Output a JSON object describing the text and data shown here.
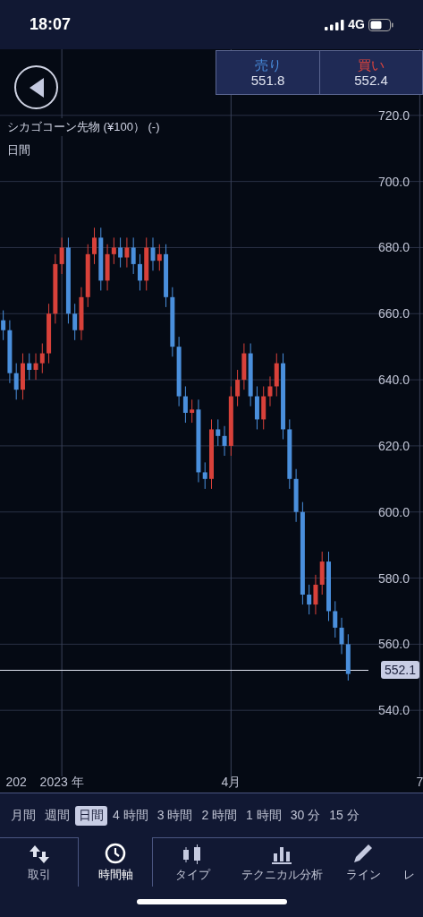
{
  "status_bar": {
    "time": "18:07",
    "network": "4G"
  },
  "quote": {
    "sell": {
      "label": "売り",
      "price": "551.8"
    },
    "buy": {
      "label": "買い",
      "price": "552.4"
    }
  },
  "chart": {
    "title": "シカゴコーン先物 (¥100） (-)",
    "period": "日間",
    "current_price": "552.1",
    "chart_data": {
      "type": "candlestick",
      "grid": true,
      "ylim": [
        520,
        740
      ],
      "ref_lines": [
        {
          "axis": "y",
          "value": 552.1,
          "color": "#e0e4f0"
        }
      ],
      "yticks": [
        {
          "value": 720,
          "label": "720.0"
        },
        {
          "value": 700,
          "label": "700.0"
        },
        {
          "value": 680,
          "label": "680.0"
        },
        {
          "value": 660,
          "label": "660.0"
        },
        {
          "value": 640,
          "label": "640.0"
        },
        {
          "value": 620,
          "label": "620.0"
        },
        {
          "value": 600,
          "label": "600.0"
        },
        {
          "value": 580,
          "label": "580.0"
        },
        {
          "value": 560,
          "label": "560.0"
        },
        {
          "value": 540,
          "label": "540.0"
        }
      ],
      "categories": [
        null,
        null,
        "202",
        null,
        null,
        null,
        null,
        null,
        null,
        "2023 年",
        null,
        null,
        null,
        null,
        null,
        null,
        null,
        null,
        null,
        null,
        null,
        null,
        null,
        null,
        null,
        null,
        null,
        null,
        null,
        null,
        null,
        null,
        null,
        null,
        null,
        "4月",
        null,
        null,
        null,
        null,
        null,
        null,
        null,
        null,
        null,
        null,
        null,
        null,
        null,
        null,
        null,
        null,
        null,
        null,
        null,
        null,
        null,
        null,
        null,
        null,
        null,
        null,
        null,
        null,
        "7"
      ],
      "ohlc": [
        [
          658,
          661,
          652,
          655
        ],
        [
          655,
          658,
          639,
          642
        ],
        [
          642,
          645,
          634,
          637
        ],
        [
          637,
          648,
          634,
          645
        ],
        [
          645,
          648,
          640,
          643
        ],
        [
          643,
          648,
          640,
          645
        ],
        [
          645,
          651,
          642,
          648
        ],
        [
          648,
          663,
          645,
          660
        ],
        [
          660,
          678,
          657,
          675
        ],
        [
          675,
          683,
          672,
          680
        ],
        [
          680,
          683,
          657,
          660
        ],
        [
          660,
          663,
          652,
          655
        ],
        [
          655,
          668,
          652,
          665
        ],
        [
          665,
          681,
          662,
          678
        ],
        [
          678,
          686,
          675,
          683
        ],
        [
          683,
          686,
          667,
          670
        ],
        [
          670,
          681,
          667,
          678
        ],
        [
          678,
          683,
          675,
          680
        ],
        [
          680,
          683,
          674,
          677
        ],
        [
          677,
          683,
          674,
          680
        ],
        [
          680,
          683,
          672,
          675
        ],
        [
          675,
          678,
          667,
          670
        ],
        [
          670,
          683,
          667,
          680
        ],
        [
          680,
          683,
          673,
          676
        ],
        [
          676,
          681,
          673,
          678
        ],
        [
          678,
          681,
          662,
          665
        ],
        [
          665,
          668,
          647,
          650
        ],
        [
          650,
          653,
          632,
          635
        ],
        [
          635,
          638,
          627,
          630
        ],
        [
          630,
          634,
          627,
          631
        ],
        [
          631,
          634,
          609,
          612
        ],
        [
          612,
          615,
          607,
          610
        ],
        [
          610,
          628,
          607,
          625
        ],
        [
          625,
          628,
          620,
          623
        ],
        [
          623,
          626,
          617,
          620
        ],
        [
          620,
          638,
          617,
          635
        ],
        [
          635,
          643,
          632,
          640
        ],
        [
          640,
          651,
          637,
          648
        ],
        [
          648,
          651,
          632,
          635
        ],
        [
          635,
          638,
          625,
          628
        ],
        [
          628,
          638,
          625,
          635
        ],
        [
          635,
          641,
          632,
          638
        ],
        [
          638,
          648,
          635,
          645
        ],
        [
          645,
          648,
          622,
          625
        ],
        [
          625,
          628,
          607,
          610
        ],
        [
          610,
          613,
          597,
          600
        ],
        [
          600,
          603,
          572,
          575
        ],
        [
          575,
          578,
          569,
          572
        ],
        [
          572,
          581,
          569,
          578
        ],
        [
          578,
          588,
          575,
          585
        ],
        [
          585,
          588,
          567,
          570
        ],
        [
          570,
          573,
          562,
          565
        ],
        [
          565,
          568,
          557,
          560
        ],
        [
          560,
          563,
          549,
          551
        ],
        null,
        null,
        null,
        null,
        null,
        null,
        null,
        null,
        null,
        null,
        null
      ]
    }
  },
  "timeframes": [
    {
      "label": "月間",
      "selected": false
    },
    {
      "label": "週間",
      "selected": false
    },
    {
      "label": "日間",
      "selected": true
    },
    {
      "label": "4 時間",
      "selected": false
    },
    {
      "label": "3 時間",
      "selected": false
    },
    {
      "label": "2 時間",
      "selected": false
    },
    {
      "label": "1 時間",
      "selected": false
    },
    {
      "label": "30 分",
      "selected": false
    },
    {
      "label": "15 分",
      "selected": false
    }
  ],
  "toolbar": [
    {
      "kind": "trade",
      "label": "取引",
      "selected": false
    },
    {
      "kind": "clock",
      "label": "時間軸",
      "selected": true
    },
    {
      "kind": "candles",
      "label": "タイプ",
      "selected": false
    },
    {
      "kind": "bars",
      "label": "テクニカル分析",
      "selected": false
    },
    {
      "kind": "pencil",
      "label": "ライン",
      "selected": false
    },
    {
      "kind": "none",
      "label": "レ",
      "selected": false
    }
  ]
}
